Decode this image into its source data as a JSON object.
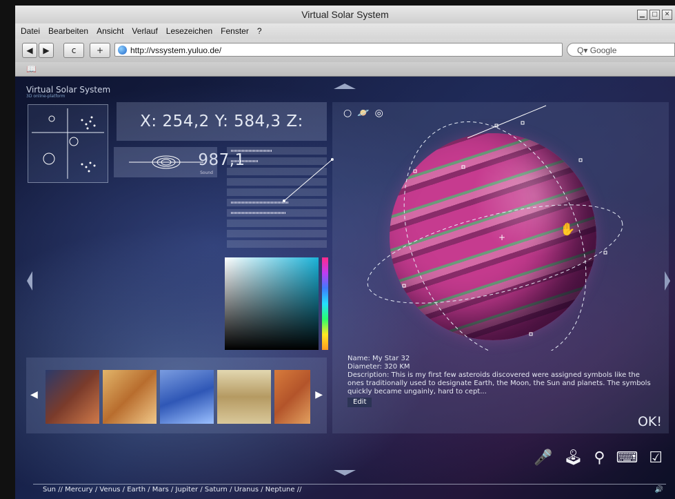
{
  "window": {
    "title": "Virtual Solar System"
  },
  "menubar": {
    "items": [
      "Datei",
      "Bearbeiten",
      "Ansicht",
      "Verlauf",
      "Lesezeichen",
      "Fenster",
      "?"
    ]
  },
  "toolbar": {
    "back": "◀",
    "forward": "▶",
    "reload": "c",
    "add": "+",
    "url": "http://vssystem.yuluo.de/",
    "search_placeholder": "Q▾ Google"
  },
  "page": {
    "logo_title": "Virtual Solar System",
    "logo_subtitle": "3D online-platform",
    "coords": "X: 254,2 Y: 584,3 Z: 987,1",
    "sound_label": "Sound",
    "planet_info": {
      "name_label": "Name: My Star 32",
      "diameter_label": "Diameter: 320 KM",
      "description": "Description: This is my first few asteroids discovered were assigned symbols like the ones traditionally used to designate Earth, the Moon, the Sun and planets. The symbols quickly became ungainly, hard to cept...",
      "edit_button": "Edit",
      "ok_button": "OK!"
    },
    "bottom_nav": "Sun // Mercury / Venus / Earth / Mars / Jupiter / Saturn / Uranus / Neptune //"
  },
  "icons": {
    "bookmark": "book-icon",
    "globe": "globe-icon",
    "orbit1": "orbit-circle-icon",
    "orbit2": "planet-ring-icon",
    "orbit3": "ring-icon",
    "microphone": "microphone-icon",
    "joystick": "joystick-icon",
    "person": "person-marker-icon",
    "keys": "arrow-keys-icon",
    "checkbox": "checkbox-icon",
    "volume": "volume-icon"
  },
  "colors": {
    "accent_cyan": "#1bb3d9",
    "planet_magenta": "#c63b8f"
  }
}
